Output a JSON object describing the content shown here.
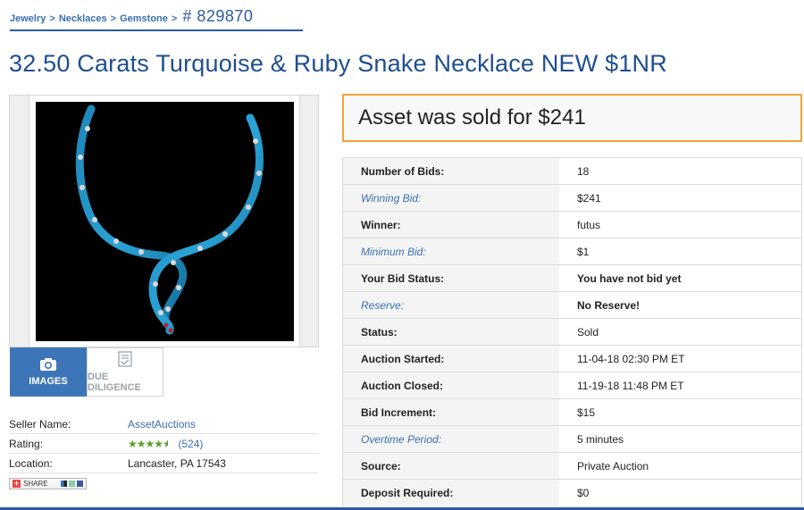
{
  "breadcrumb": {
    "items": [
      "Jewelry",
      "Necklaces",
      "Gemstone"
    ],
    "separator": ">",
    "lot_number": "# 829870"
  },
  "listing": {
    "title": "32.50 Carats Turquoise & Ruby Snake Necklace NEW $1NR"
  },
  "media_tabs": {
    "images_label": "IMAGES",
    "due_diligence_label": "DUE DILIGENCE"
  },
  "seller": {
    "name_label": "Seller Name:",
    "name_value": "AssetAuctions",
    "rating_label": "Rating:",
    "rating_stars": 4.5,
    "rating_count": "(524)",
    "location_label": "Location:",
    "location_value": "Lancaster, PA 17543",
    "share_label": "SHARE"
  },
  "sold_banner": {
    "text": "Asset was sold for $241"
  },
  "details": [
    {
      "label": "Number of Bids:",
      "value": "18",
      "style": "normal"
    },
    {
      "label": "Winning Bid:",
      "value": "$241",
      "style": "em"
    },
    {
      "label": "Winner:",
      "value": "futus",
      "style": "normal"
    },
    {
      "label": "Minimum Bid:",
      "value": "$1",
      "style": "em"
    },
    {
      "label": "Your Bid Status:",
      "value": "You have not bid yet",
      "style": "normal",
      "bold_value": true
    },
    {
      "label": "Reserve:",
      "value": "No Reserve!",
      "style": "em",
      "bold_value": true
    },
    {
      "label": "Status:",
      "value": "Sold",
      "style": "normal"
    },
    {
      "label": "Auction Started:",
      "value": "11-04-18 02:30 PM ET",
      "style": "normal"
    },
    {
      "label": "Auction Closed:",
      "value": "11-19-18 11:48 PM ET",
      "style": "normal"
    },
    {
      "label": "Bid Increment:",
      "value": "$15",
      "style": "normal"
    },
    {
      "label": "Overtime Period:",
      "value": "5 minutes",
      "style": "em"
    },
    {
      "label": "Source:",
      "value": "Private Auction",
      "style": "normal"
    },
    {
      "label": "Deposit Required:",
      "value": "$0",
      "style": "normal"
    }
  ],
  "colors": {
    "brand_blue": "#2a5ba0",
    "link_blue": "#3a6fb0",
    "sold_border": "#f0a23a",
    "star_green": "#5aa02c"
  }
}
